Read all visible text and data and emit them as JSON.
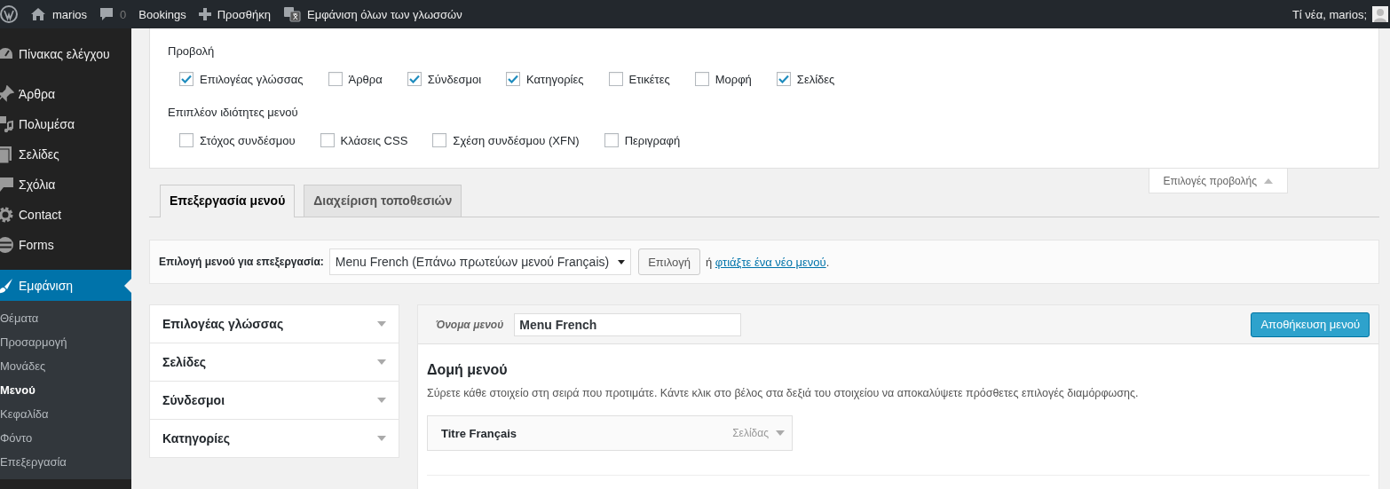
{
  "admin_bar": {
    "items": [
      {
        "kind": "logo"
      },
      {
        "kind": "home",
        "label": "marios"
      },
      {
        "kind": "comments",
        "label": "0"
      },
      {
        "kind": "text",
        "label": "Bookings"
      },
      {
        "kind": "plus",
        "label": "Προσθήκη"
      },
      {
        "kind": "translate",
        "label": "Εμφάνιση όλων των γλωσσών"
      }
    ],
    "greeting": "Τί νέα, marios;"
  },
  "sidebar": {
    "items": [
      {
        "label": "Πίνακας ελέγχου",
        "selected": false
      },
      {
        "label": "Άρθρα",
        "selected": false
      },
      {
        "label": "Πολυμέσα",
        "selected": false
      },
      {
        "label": "Σελίδες",
        "selected": false
      },
      {
        "label": "Σχόλια",
        "selected": false
      },
      {
        "label": "Contact",
        "selected": false
      },
      {
        "label": "Forms",
        "selected": false
      },
      {
        "label": "Εμφάνιση",
        "selected": true,
        "children": [
          {
            "label": "Θέματα",
            "selected": false
          },
          {
            "label": "Προσαρμογή",
            "selected": false
          },
          {
            "label": "Μονάδες",
            "selected": false
          },
          {
            "label": "Μενού",
            "selected": true
          },
          {
            "label": "Κεφαλίδα",
            "selected": false
          },
          {
            "label": "Φόντο",
            "selected": false
          },
          {
            "label": "Επεξεργασία",
            "selected": false
          }
        ]
      }
    ]
  },
  "screen_options": {
    "groups": [
      {
        "title": "Προβολή",
        "options": [
          {
            "label": "Επιλογέας γλώσσας",
            "checked": true
          },
          {
            "label": "Άρθρα",
            "checked": false
          },
          {
            "label": "Σύνδεσμοι",
            "checked": true
          },
          {
            "label": "Κατηγορίες",
            "checked": true
          },
          {
            "label": "Ετικέτες",
            "checked": false
          },
          {
            "label": "Μορφή",
            "checked": false
          },
          {
            "label": "Σελίδες",
            "checked": true
          }
        ]
      },
      {
        "title": "Επιπλέον ιδιότητες μενού",
        "options": [
          {
            "label": "Στόχος συνδέσμου",
            "checked": false
          },
          {
            "label": "Κλάσεις CSS",
            "checked": false
          },
          {
            "label": "Σχέση συνδέσμου (XFN)",
            "checked": false
          },
          {
            "label": "Περιγραφή",
            "checked": false
          }
        ]
      }
    ],
    "toggle": "Επιλογές προβολής"
  },
  "tabs": [
    {
      "label": "Επεξεργασία μενού",
      "selected": true
    },
    {
      "label": "Διαχείριση τοποθεσιών",
      "selected": false
    }
  ],
  "menu_select": {
    "label": "Επιλογή μενού για επεξεργασία:",
    "value": "Menu French (Επάνω πρωτεύων μενού Français)",
    "button": "Επιλογή",
    "or": "ή",
    "link": "φτιάξτε ένα νέο μενού",
    "after": "."
  },
  "accordion": [
    {
      "label": "Επιλογέας γλώσσας"
    },
    {
      "label": "Σελίδες"
    },
    {
      "label": "Σύνδεσμοι"
    },
    {
      "label": "Κατηγορίες"
    }
  ],
  "menu_editor": {
    "name_label": "Όνομα μενού",
    "name_value": "Menu French",
    "save": "Αποθήκευση μενού",
    "structure_title": "Δομή μενού",
    "instructions": "Σύρετε κάθε στοιχείο στη σειρά που προτιμάτε. Κάντε κλικ στο βέλος στα δεξιά του στοιχείου να αποκαλύψετε πρόσθετες επιλογές διαμόρφωσης.",
    "items": [
      {
        "title": "Titre Français",
        "type": "Σελίδας"
      }
    ]
  }
}
